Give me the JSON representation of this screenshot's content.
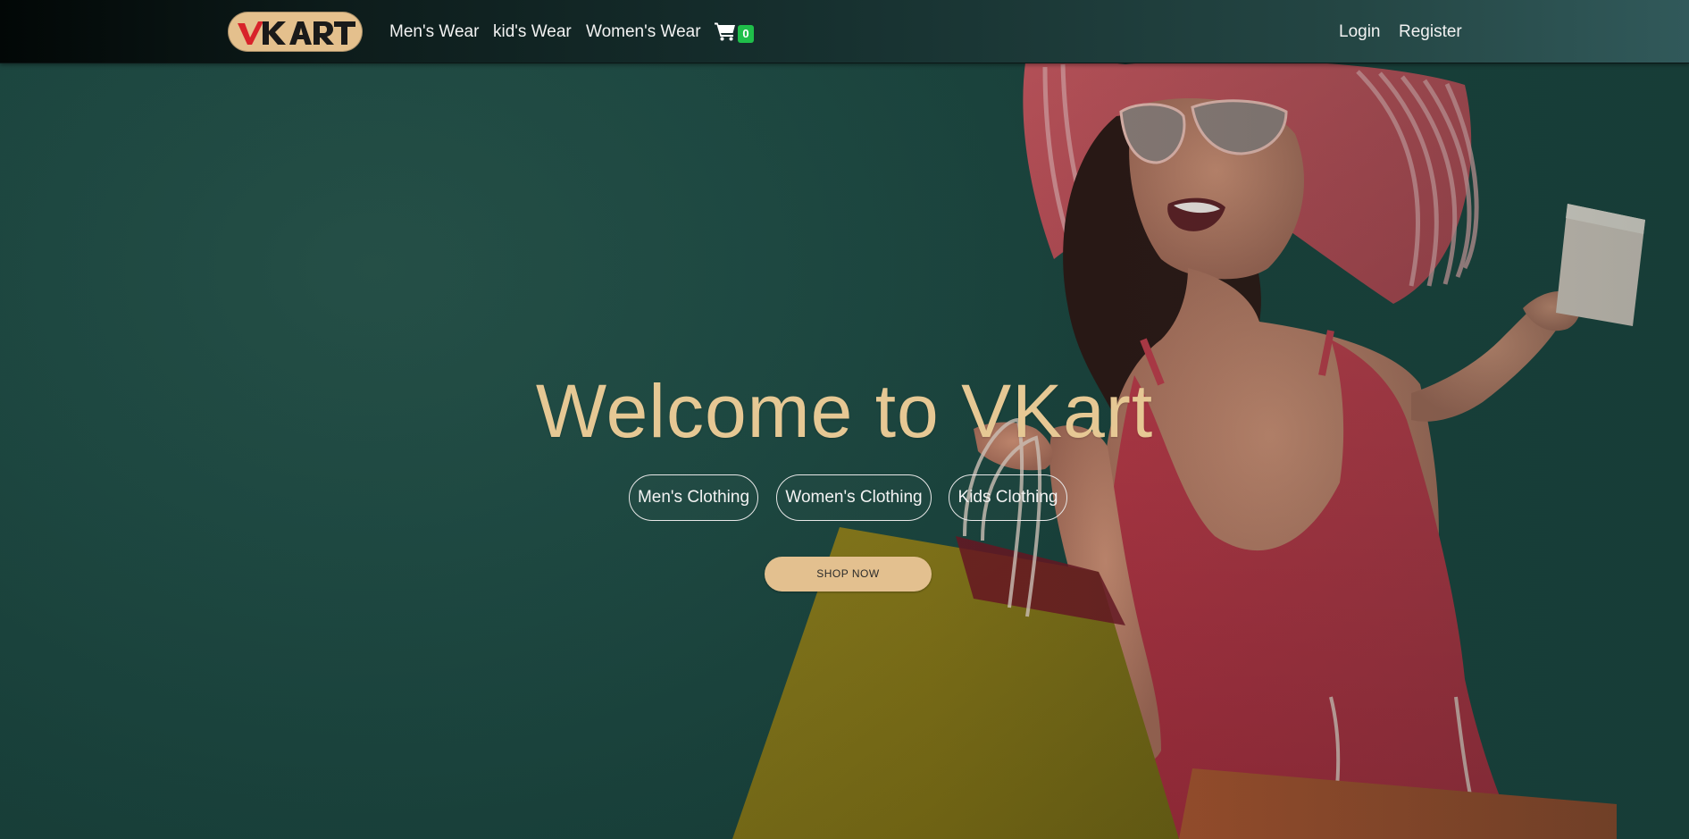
{
  "brand": {
    "logo_text": "VKART",
    "colors": {
      "logo_bg": "#e4c08d",
      "logo_v": "#d8232a",
      "logo_kart": "#1a1a1a"
    }
  },
  "nav": {
    "links": [
      {
        "label": "Men's Wear"
      },
      {
        "label": "kid's Wear"
      },
      {
        "label": "Women's Wear"
      }
    ],
    "cart": {
      "icon": "shopping-cart-icon",
      "count": "0"
    },
    "login_label": "Login",
    "register_label": "Register"
  },
  "hero": {
    "title": "Welcome to VKart",
    "categories": [
      {
        "label": "Men's Clothing"
      },
      {
        "label": "Women's Clothing"
      },
      {
        "label": "Kids Clothing"
      }
    ],
    "cta_label": "SHOP NOW",
    "image": "woman-with-shopping-bags",
    "colors": {
      "background": "#1f4a43",
      "title": "#e6c894",
      "cta_bg": "#e3c08f",
      "badge": "#1fbf4a"
    }
  }
}
